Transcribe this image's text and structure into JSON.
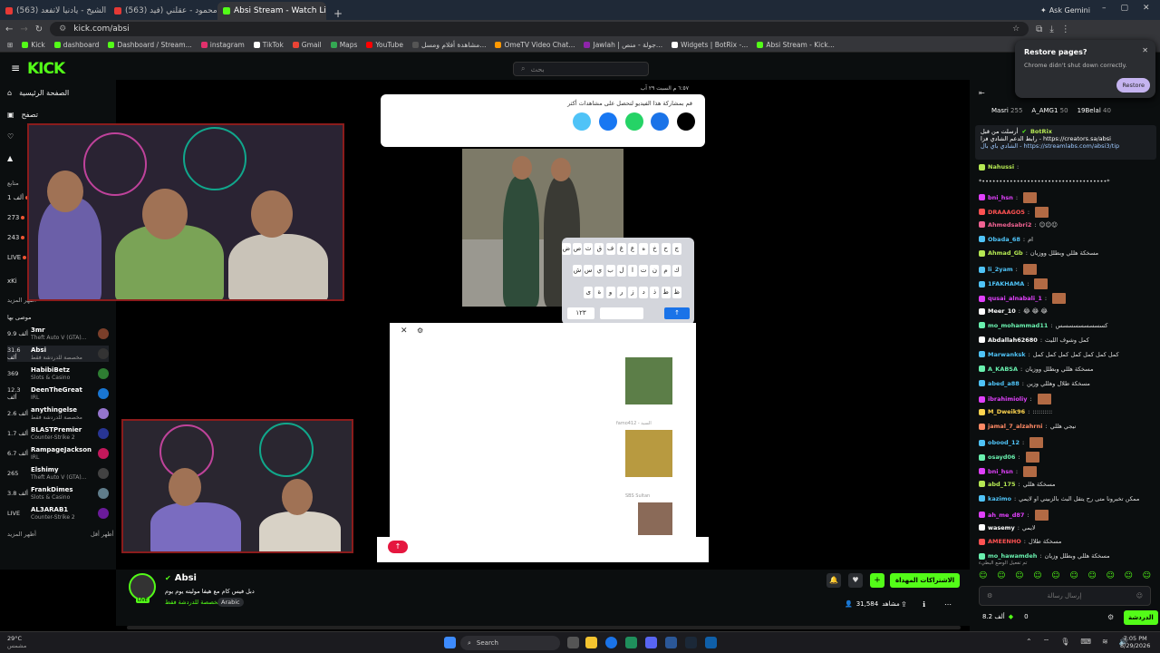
{
  "browser": {
    "tabs": [
      {
        "label": "(563) ودیع الشیخ - یادنیا لاتفعد...",
        "color": "#e53935",
        "active": false
      },
      {
        "label": "(563) صباح محمود - عقلني (فيد...",
        "color": "#e53935",
        "active": false
      },
      {
        "label": "Absi Stream - Watch Live o...",
        "color": "#53fc18",
        "active": true
      }
    ],
    "url": "kick.com/absi",
    "gemini": "Ask Gemini",
    "bookmarks": [
      {
        "label": "Kick",
        "color": "#53fc18"
      },
      {
        "label": "dashboard",
        "color": "#53fc18"
      },
      {
        "label": "Dashboard / Stream...",
        "color": "#53fc18"
      },
      {
        "label": "instagram",
        "color": "#e1306c"
      },
      {
        "label": "TikTok",
        "color": "#ffffff"
      },
      {
        "label": "Gmail",
        "color": "#ea4335"
      },
      {
        "label": "Maps",
        "color": "#34a853"
      },
      {
        "label": "YouTube",
        "color": "#ff0000"
      },
      {
        "label": "مشاهدة أفلام ومسل...",
        "color": "#555555"
      },
      {
        "label": "OmeTV Video Chat...",
        "color": "#ff9800"
      },
      {
        "label": "Jawlah | جولة - منص...",
        "color": "#8e24aa"
      },
      {
        "label": "Widgets | BotRix -...",
        "color": "#ffffff"
      },
      {
        "label": "Absi Stream - Kick...",
        "color": "#53fc18"
      }
    ]
  },
  "restore": {
    "title": "Restore pages?",
    "text": "Chrome didn't shut down correctly.",
    "button": "Restore"
  },
  "kick": {
    "logo": "KICK",
    "search_placeholder": "بحث",
    "nav": [
      "الصفحة الرئيسية",
      "تصفح"
    ],
    "following_label": "متابع",
    "following_counts": [
      "1 ألف",
      "273",
      "243",
      "LIVE",
      "xKi"
    ],
    "show_more": "أظهر المزيد",
    "recommended_label": "موصى بها",
    "channels": [
      {
        "count": "9.9 ألف",
        "name": "3mr",
        "sub": "Theft Auto V (GTA)...",
        "color": "#7b3f2a"
      },
      {
        "count": "31.6 ألف",
        "name": "Absi",
        "sub": "مخصصة للدردشة فقط",
        "color": "#333333",
        "selected": true
      },
      {
        "count": "369",
        "name": "HabibiBetz",
        "sub": "Slots & Casino",
        "color": "#2e7d32"
      },
      {
        "count": "12.3 ألف",
        "name": "DeenTheGreat",
        "sub": "IRL",
        "color": "#1976d2"
      },
      {
        "count": "2.6 ألف",
        "name": "anythingelse",
        "sub": "مخصصة للدردشة فقط",
        "color": "#9575cd"
      },
      {
        "count": "1.7 ألف",
        "name": "BLASTPremier",
        "sub": "Counter-Strike 2",
        "color": "#283593"
      },
      {
        "count": "6.7 ألف",
        "name": "RampageJackson",
        "sub": "IRL",
        "color": "#c2185b"
      },
      {
        "count": "265",
        "name": "Elshimy",
        "sub": "Theft Auto V (GTA)...",
        "color": "#424242"
      },
      {
        "count": "3.8 ألف",
        "name": "FrankDimes",
        "sub": "Slots & Casino",
        "color": "#607d8b"
      },
      {
        "count": "LIVE",
        "name": "AL3ARAB1",
        "sub": "Counter-Strike 2",
        "color": "#6a1b9a"
      }
    ],
    "show_more2": "أظهر المزيد",
    "show_less": "أظهر أقل",
    "streamer": {
      "name": "Absi",
      "title": "دبل فيس كام مع هيفا موليته يوم يوم",
      "category": "مخصصة للدردشة فقط",
      "tag": "Arabic",
      "viewers": "31,584",
      "viewers_label": "مشاهد",
      "live": "LIVE",
      "subscribe": "الاشتراكات المهداة"
    }
  },
  "phone": {
    "status": "٦:٥٧ م  السبت ٢٩ آب",
    "share_text": "قم بمشاركة هذا الفيديو لتحصل على مشاهدات أكثر",
    "share_icons": [
      {
        "name": "X",
        "color": "#000000"
      },
      {
        "name": "link",
        "color": "#1a73e8"
      },
      {
        "name": "WhatsApp",
        "color": "#25d366"
      },
      {
        "name": "Facebook",
        "color": "#1877f2"
      },
      {
        "name": "more",
        "color": "#4fc3f7"
      }
    ],
    "kbd_rows": [
      "ج ح خ ه ع غ ف ق ث ص ض",
      "ك م ن ت ا ل ب ي س ش",
      "ظ ط ذ د ز ر و ة ى"
    ],
    "kbd_num": "١٢٣",
    "chat_names": [
      "famo412 - السيد",
      "SBS Sultan"
    ]
  },
  "chat": {
    "pinned": [
      {
        "name": "Masri",
        "n": "255"
      },
      {
        "name": "A_AMG1",
        "n": "50"
      },
      {
        "name": "19Belal",
        "n": "40"
      }
    ],
    "bot": {
      "name": "BotRix",
      "text": "رابط الدعم الشادي فزا - https://creators.sa/absi",
      "text2": "الشادي باي بال - https://streamlabs.com/absi3/tip",
      "label": "أرسلت من قبل"
    },
    "messages": [
      {
        "user": "Nahussi",
        "color": "#b5e853",
        "text": ""
      },
      {
        "user": "",
        "color": "#dddddd",
        "text": "*••••••••••••••••••••••••••••••••••••*"
      },
      {
        "user": "bni_hsn",
        "color": "#e040fb",
        "text": "",
        "emote": true
      },
      {
        "user": "DRAAAGO5",
        "color": "#ff5252",
        "text": "",
        "emote": true
      },
      {
        "user": "Ahmedsabri2",
        "color": "#f06292",
        "text": "☺☺☺"
      },
      {
        "user": "Obada_68",
        "color": "#4fc3f7",
        "text": "ام"
      },
      {
        "user": "Ahmad_Gb",
        "color": "#b5e853",
        "text": "مسخكة هللي وبطلل ووزيان"
      },
      {
        "user": "li_2yam",
        "color": "#4fc3f7",
        "text": "",
        "emote": true
      },
      {
        "user": "1FAKHAMA",
        "color": "#4fc3f7",
        "text": "",
        "emote": true
      },
      {
        "user": "qusai_alnabali_1",
        "color": "#e040fb",
        "text": "",
        "emote": true
      },
      {
        "user": "Meer_10",
        "color": "#ffffff",
        "text": "😂 😂 😂"
      },
      {
        "user": "mo_mohammad11",
        "color": "#69f0ae",
        "text": "كسسسسسسسسس"
      },
      {
        "user": "Abdallah62680",
        "color": "#ffffff",
        "text": "كمل وشوف الليث"
      },
      {
        "user": "Marwanksk",
        "color": "#4fc3f7",
        "text": "كمل كمل كمل كمل كمل كمل كمل"
      },
      {
        "user": "A_KABSA",
        "color": "#69f0ae",
        "text": "مسخكة هللي وبطلل ووزيان"
      },
      {
        "user": "abed_a88",
        "color": "#4fc3f7",
        "text": "مسخكة طلال وهللي وزين"
      },
      {
        "user": "ibrahimioliy",
        "color": "#e040fb",
        "text": "",
        "emote": true
      },
      {
        "user": "M_Dweik96",
        "color": "#ffd54f",
        "text": "::::::::::"
      },
      {
        "user": "jamal_7_alzahrni",
        "color": "#ff8a65",
        "text": "نيجي هللي"
      },
      {
        "user": "obood_12",
        "color": "#4fc3f7",
        "text": "",
        "emote": true
      },
      {
        "user": "osayd06",
        "color": "#69f0ae",
        "text": "",
        "emote": true
      },
      {
        "user": "bni_hsn",
        "color": "#e040fb",
        "text": "",
        "emote": true
      },
      {
        "user": "abd_175",
        "color": "#b5e853",
        "text": "مسخكة هللي"
      },
      {
        "user": "kazimo",
        "color": "#4fc3f7",
        "text": "ممكن تخبرونا متى رح يتقل البث بالزبيني او لايمي"
      },
      {
        "user": "ah_me_d87",
        "color": "#e040fb",
        "text": "",
        "emote": true
      },
      {
        "user": "wasemy",
        "color": "#ffffff",
        "text": "لايمي"
      },
      {
        "user": "AMEENHO",
        "color": "#ff5252",
        "text": "مسخكة طلال"
      },
      {
        "user": "mo_hawamdeh",
        "color": "#69f0ae",
        "text": "مسخكة هللي وبطلل وزيان"
      }
    ],
    "input_placeholder": "إرسال رسالة",
    "send": "الدردشة",
    "points": "8.2 ألف",
    "zero": "0",
    "mode_note": "تم تفعيل الوضع البطيء"
  },
  "taskbar": {
    "temp": "29°C",
    "weather": "مشمس",
    "search": "Search",
    "time": "7:05 PM",
    "date": "8/29/2026"
  }
}
